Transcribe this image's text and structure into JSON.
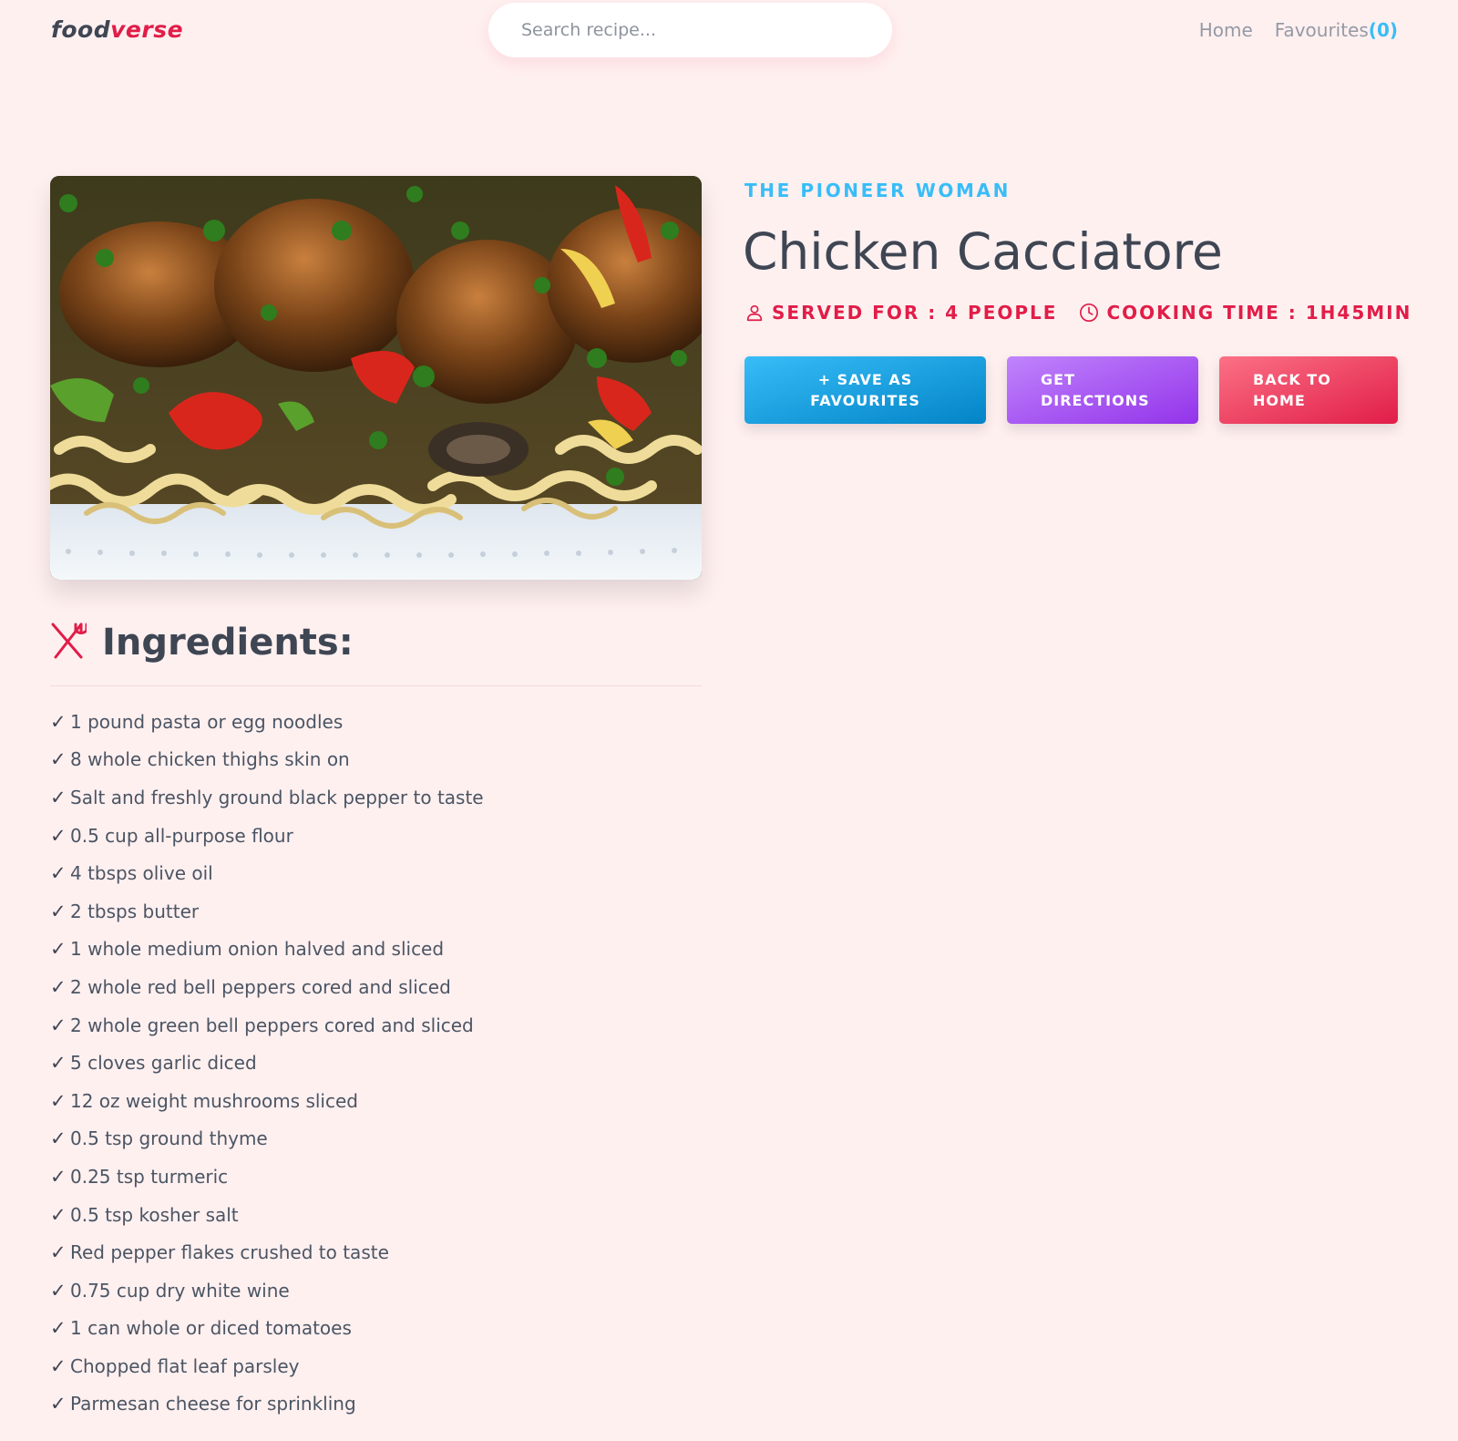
{
  "header": {
    "logo_part1": "food",
    "logo_part2": "verse",
    "search_placeholder": "Search recipe...",
    "nav": {
      "home": "Home",
      "favourites": "Favourites",
      "favourites_count": "(0)"
    }
  },
  "recipe": {
    "image_alt": "Chicken Cacciatore",
    "publisher": "THE PIONEER WOMAN",
    "title": "Chicken Cacciatore",
    "served_for": "SERVED FOR : 4 PEOPLE",
    "cooking_time": "COOKING TIME : 1H45MIN",
    "actions": {
      "save": "+ SAVE AS\nFAVOURITES",
      "directions": "GET\nDIRECTIONS",
      "back": "BACK TO\nHOME"
    }
  },
  "ingredients": {
    "heading": "Ingredients:",
    "check_mark": "✓",
    "items": [
      "1 pound pasta or egg noodles",
      "8 whole chicken thighs skin on",
      "Salt and freshly ground black pepper to taste",
      "0.5 cup all-purpose flour",
      "4 tbsps olive oil",
      "2 tbsps butter",
      "1 whole medium onion halved and sliced",
      "2 whole red bell peppers cored and sliced",
      "2 whole green bell peppers cored and sliced",
      "5 cloves garlic diced",
      "12 oz weight mushrooms sliced",
      "0.5 tsp ground thyme",
      "0.25 tsp turmeric",
      "0.5 tsp kosher salt",
      "Red pepper flakes crushed to taste",
      "0.75 cup dry white wine",
      "1 can whole or diced tomatoes",
      "Chopped flat leaf parsley",
      "Parmesan cheese for sprinkling"
    ]
  },
  "icons": {
    "user": "user-icon",
    "clock": "clock-icon",
    "utensils": "fork-knife-icon"
  },
  "colors": {
    "background": "#fff0f0",
    "brand_red": "#e11d48",
    "accent_blue": "#38bdf8",
    "text_dark": "#3f4653"
  }
}
